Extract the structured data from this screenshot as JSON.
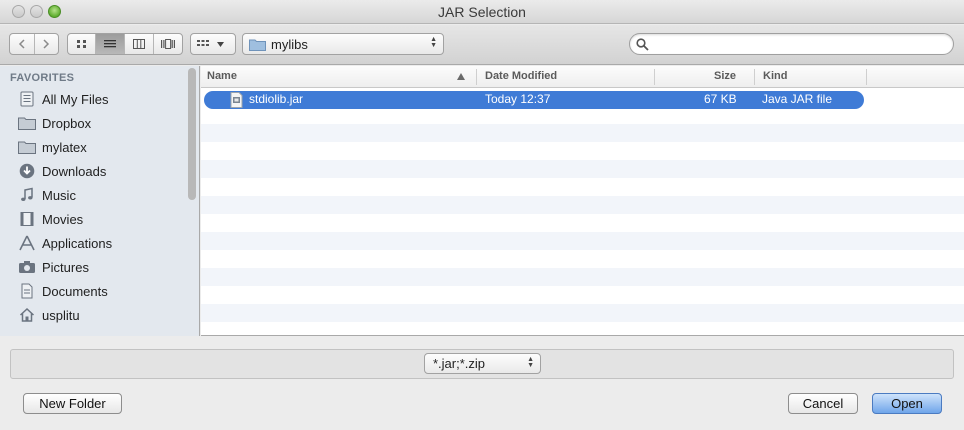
{
  "window": {
    "title": "JAR Selection"
  },
  "toolbar": {
    "location": "mylibs",
    "search_placeholder": "",
    "view_modes": [
      "icon",
      "list",
      "column",
      "coverflow"
    ],
    "active_view": "list"
  },
  "sidebar": {
    "heading": "FAVORITES",
    "items": [
      {
        "label": "All My Files",
        "icon": "all-files-icon"
      },
      {
        "label": "Dropbox",
        "icon": "folder-icon"
      },
      {
        "label": "mylatex",
        "icon": "folder-icon"
      },
      {
        "label": "Downloads",
        "icon": "downloads-icon"
      },
      {
        "label": "Music",
        "icon": "music-icon"
      },
      {
        "label": "Movies",
        "icon": "movies-icon"
      },
      {
        "label": "Applications",
        "icon": "applications-icon"
      },
      {
        "label": "Pictures",
        "icon": "camera-icon"
      },
      {
        "label": "Documents",
        "icon": "documents-icon"
      },
      {
        "label": "usplitu",
        "icon": "home-icon"
      }
    ]
  },
  "filelist": {
    "columns": {
      "name": "Name",
      "date": "Date Modified",
      "size": "Size",
      "kind": "Kind"
    },
    "rows": [
      {
        "name": "stdiolib.jar",
        "date": "Today 12:37",
        "size": "67 KB",
        "kind": "Java JAR file",
        "selected": true
      }
    ]
  },
  "footer": {
    "filter": "*.jar;*.zip",
    "new_folder": "New Folder",
    "cancel": "Cancel",
    "open": "Open"
  },
  "colors": {
    "selection": "#3f7bd6",
    "sidebar_bg": "#e3e8ee"
  }
}
